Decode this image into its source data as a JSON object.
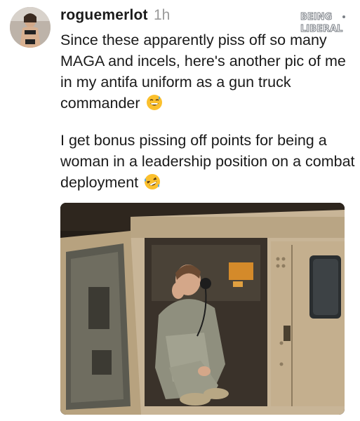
{
  "post": {
    "username": "roguemerlot",
    "timestamp": "1h",
    "paragraphs": [
      "Since these apparently piss off so many MAGA and incels, here's another pic of me in my antifa uniform as a gun truck commander",
      "I get bonus pissing off points for being a woman in a leadership position on a combat deployment"
    ],
    "emojis": [
      "grinning-sweat-emoji",
      "rolling-on-floor-laughing-emoji"
    ]
  },
  "watermark": {
    "line1": "BEING",
    "line2": "LIBERAL"
  },
  "colors": {
    "text": "#1a1a1a",
    "timestamp": "#9a9a9a",
    "watermark": "#7a7f86"
  }
}
